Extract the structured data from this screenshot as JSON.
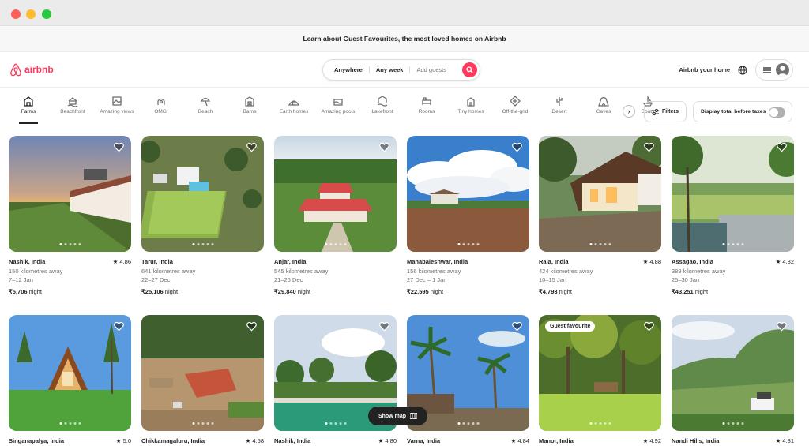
{
  "banner": "Learn about Guest Favourites, the most loved homes on Airbnb",
  "logo": "airbnb",
  "search": {
    "where": "Anywhere",
    "when": "Any week",
    "guests": "Add guests"
  },
  "header": {
    "host": "Airbnb your home"
  },
  "categories": [
    {
      "label": "Farms",
      "icon": "farm-icon",
      "active": true
    },
    {
      "label": "Beachfront",
      "icon": "beachfront-icon"
    },
    {
      "label": "Amazing views",
      "icon": "views-icon"
    },
    {
      "label": "OMG!",
      "icon": "omg-icon"
    },
    {
      "label": "Beach",
      "icon": "beach-umbrella-icon"
    },
    {
      "label": "Barns",
      "icon": "barn-icon"
    },
    {
      "label": "Earth homes",
      "icon": "earth-home-icon"
    },
    {
      "label": "Amazing pools",
      "icon": "pool-icon"
    },
    {
      "label": "Lakefront",
      "icon": "lakefront-icon"
    },
    {
      "label": "Rooms",
      "icon": "bed-icon"
    },
    {
      "label": "Tiny homes",
      "icon": "tiny-home-icon"
    },
    {
      "label": "Off-the-grid",
      "icon": "off-grid-icon"
    },
    {
      "label": "Desert",
      "icon": "cactus-icon"
    },
    {
      "label": "Caves",
      "icon": "cave-icon"
    },
    {
      "label": "Boats",
      "icon": "boat-icon"
    }
  ],
  "filters": {
    "label": "Filters",
    "taxes": "Display total before taxes"
  },
  "listings": [
    {
      "location": "Nashik, India",
      "rating": "4.86",
      "distance": "150 kilometres away",
      "dates": "7–12 Jan",
      "price": "₹5,706",
      "night": "night",
      "scene": "sunset-farm"
    },
    {
      "location": "Tarur, India",
      "rating": "",
      "distance": "641 kilometres away",
      "dates": "22–27 Dec",
      "price": "₹25,106",
      "night": "night",
      "scene": "aerial-villa"
    },
    {
      "location": "Anjar, India",
      "rating": "",
      "distance": "545 kilometres away",
      "dates": "21–26 Dec",
      "price": "₹29,840",
      "night": "night",
      "scene": "red-roof-estate"
    },
    {
      "location": "Mahabaleshwar, India",
      "rating": "",
      "distance": "156 kilometres away",
      "dates": "27 Dec – 1 Jan",
      "price": "₹22,595",
      "night": "night",
      "scene": "cloud-field"
    },
    {
      "location": "Raia, India",
      "rating": "4.88",
      "distance": "424 kilometres away",
      "dates": "10–15 Jan",
      "price": "₹4,793",
      "night": "night",
      "scene": "cottage-dusk"
    },
    {
      "location": "Assagao, India",
      "rating": "4.82",
      "distance": "389 kilometres away",
      "dates": "25–30 Jan",
      "price": "₹43,251",
      "night": "night",
      "scene": "jungle-pool"
    },
    {
      "location": "Singanapalya, India",
      "rating": "5.0",
      "badge": "",
      "scene": "a-frame"
    },
    {
      "location": "Chikkamagaluru, India",
      "rating": "4.58",
      "badge": "",
      "scene": "aerial-house"
    },
    {
      "location": "Nashik, India",
      "rating": "4.80",
      "badge": "",
      "scene": "green-pool"
    },
    {
      "location": "Varna, India",
      "rating": "4.84",
      "badge": "",
      "scene": "palms"
    },
    {
      "location": "Manor, India",
      "rating": "4.92",
      "badge": "Guest favourite",
      "scene": "forest-lawn"
    },
    {
      "location": "Nandi Hills, India",
      "rating": "4.81",
      "badge": "",
      "scene": "hills"
    }
  ],
  "show_map": "Show map"
}
